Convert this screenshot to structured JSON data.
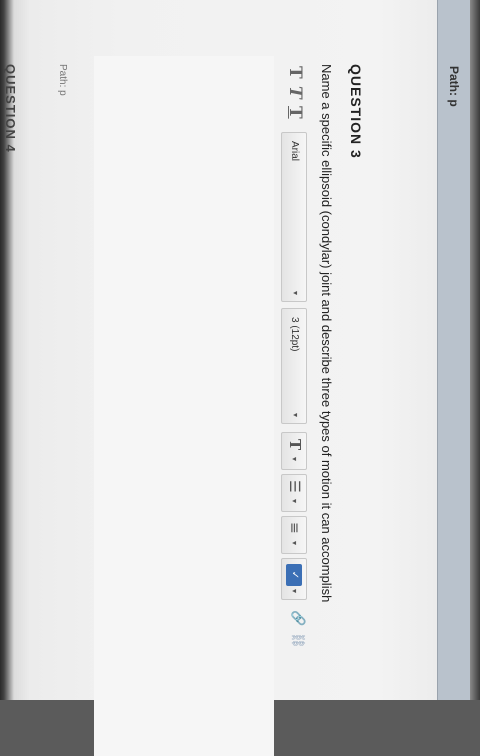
{
  "top_path_bar": {
    "label": "Path: p"
  },
  "question": {
    "header": "QUESTION 3",
    "prompt": "Name a specific ellipsoid (condylar) joint and describe three types of motion it can accomplish"
  },
  "toolbar": {
    "format_buttons": [
      "T",
      "T",
      "T"
    ],
    "font_family": "Arial",
    "font_size": "3 (12pt)",
    "text_color_label": "T",
    "dropdown_arrow": "▾"
  },
  "editor": {
    "path_label": "Path: p"
  },
  "next_question": {
    "header": "QUESTION 4"
  }
}
